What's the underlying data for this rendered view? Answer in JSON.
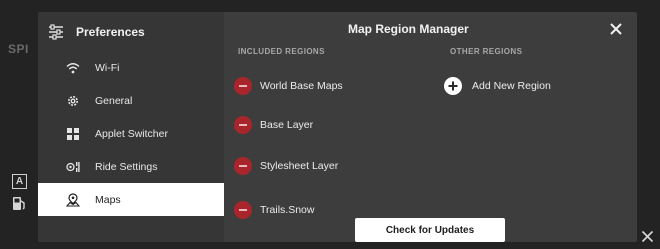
{
  "background": {
    "partial_label": "SPI",
    "badge_letter": "A",
    "icons": [
      "fuel-icon",
      "close-icon"
    ]
  },
  "sidebar": {
    "title": "Preferences",
    "icon": "sliders-icon",
    "items": [
      {
        "label": "Wi-Fi",
        "icon": "wifi-icon",
        "active": false
      },
      {
        "label": "General",
        "icon": "gear-icon",
        "active": false
      },
      {
        "label": "Applet Switcher",
        "icon": "grid-icon",
        "active": false
      },
      {
        "label": "Ride Settings",
        "icon": "toggle-settings-icon",
        "active": false
      },
      {
        "label": "Maps",
        "icon": "map-icon",
        "active": true
      }
    ]
  },
  "main": {
    "title": "Map Region Manager",
    "close_icon": "close-icon",
    "included_heading": "INCLUDED REGIONS",
    "other_heading": "OTHER REGIONS",
    "included_regions": [
      {
        "label": "World Base Maps"
      },
      {
        "label": "Base Layer"
      },
      {
        "label": "Stylesheet Layer"
      },
      {
        "label": "Trails.Snow"
      }
    ],
    "add_region_label": "Add New Region",
    "check_updates_label": "Check for Updates"
  },
  "colors": {
    "modal_bg": "#3d3d3d",
    "sidebar_bg": "#363636",
    "active_item_bg": "#ffffff",
    "remove_button": "#a8262b",
    "button_bg": "#ffffff"
  }
}
